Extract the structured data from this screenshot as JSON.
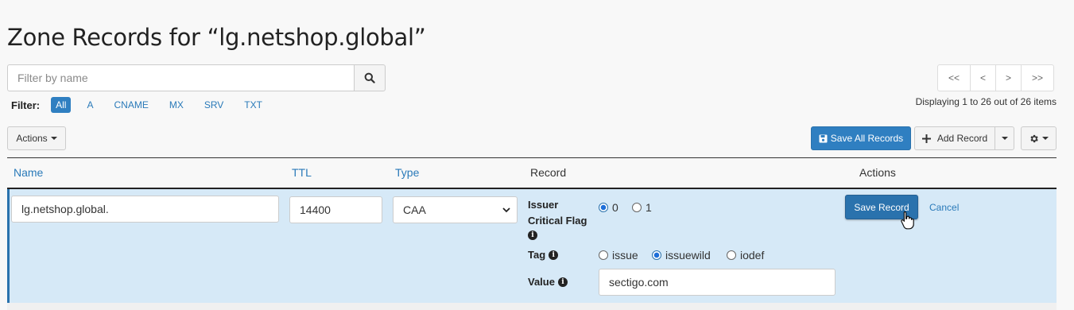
{
  "page": {
    "title": "Zone Records for “lg.netshop.global”"
  },
  "search": {
    "placeholder": "Filter by name"
  },
  "filter": {
    "label": "Filter:",
    "options": [
      "All",
      "A",
      "CNAME",
      "MX",
      "SRV",
      "TXT"
    ],
    "active": "All"
  },
  "pagination": {
    "first": "<<",
    "prev": "<",
    "next": ">",
    "last": ">>",
    "summary": "Displaying 1 to 26 out of 26 items"
  },
  "toolbar": {
    "actions_label": "Actions",
    "save_all_label": "Save All Records",
    "add_record_label": "Add Record"
  },
  "table": {
    "columns": [
      "Name",
      "TTL",
      "Type",
      "Record",
      "Actions"
    ]
  },
  "edit_row": {
    "name_value": "lg.netshop.global.",
    "ttl_value": "14400",
    "type_value": "CAA",
    "issuer_label": "Issuer Critical Flag",
    "issuer_options": [
      "0",
      "1"
    ],
    "issuer_selected": "0",
    "tag_label": "Tag",
    "tag_options": [
      "issue",
      "issuewild",
      "iodef"
    ],
    "tag_selected": "issuewild",
    "value_label": "Value",
    "value_value": "sectigo.com",
    "save_label": "Save Record",
    "cancel_label": "Cancel"
  },
  "colors": {
    "primary": "#2f7fc1",
    "link": "#2a7ab9",
    "edit_row_bg": "#d6e9f7"
  }
}
